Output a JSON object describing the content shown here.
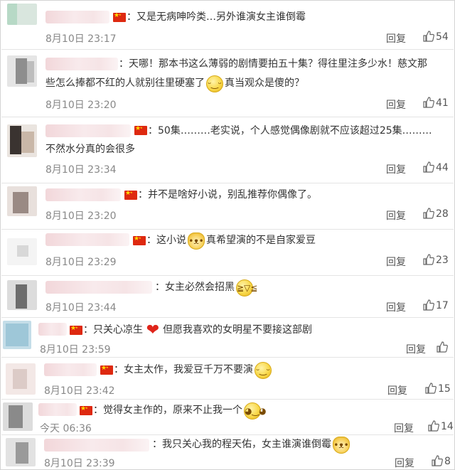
{
  "reply_label": "回复",
  "colors": {
    "flag_red": "#de2910",
    "flag_yellow": "#ffde00",
    "username_blur": "#f2d7da",
    "timestamp": "#888888"
  },
  "comments": [
    {
      "text": "：又是无病呻吟类…另外谁演女主谁倒霉",
      "time": "8月10日 23:17",
      "likes": "54"
    },
    {
      "text_line1": "：天哪！那本书这么薄弱的剧情要拍五十集？得往里注多少水！慈文那",
      "text_line2_a": "些怎么捧都不红的人就别往里硬塞了",
      "emoji": "thinking-emoji",
      "text_line2_b": "真当观众是傻的？",
      "time": "8月10日 23:20",
      "likes": "41"
    },
    {
      "text_line1": "：50集………老实说，个人感觉偶像剧就不应该超过25集………",
      "text_line2": "不然水分真的会很多",
      "time": "8月10日 23:34",
      "likes": "44"
    },
    {
      "text": "：并不是啥好小说，别乱推荐你偶像了。",
      "time": "8月10日 23:20",
      "likes": "28"
    },
    {
      "text_a": "：这小说",
      "emoji": "cat-emoji",
      "text_b": "真希望演的不是自家爱豆",
      "time": "8月10日 23:29",
      "likes": "23"
    },
    {
      "text": "：女主必然会招黑",
      "emoji": "laugh-cry-emoji",
      "time": "8月10日 23:44",
      "likes": "17"
    },
    {
      "text_a": "：只关心凉生",
      "emoji": "heart-emoji",
      "text_b": "但愿我喜欢的女明星不要接这部剧",
      "time": "8月10日 23:59",
      "likes": ""
    },
    {
      "text": "：女主太作，我爱豆千万不要演",
      "emoji": "thinking-emoji",
      "time": "8月10日 23:42",
      "likes": "15"
    },
    {
      "text": "：觉得女主作的，原来不止我一个",
      "emoji": "smile-emoji",
      "time": "今天 06:36",
      "likes": "14"
    },
    {
      "text": "：我只关心我的程天佑，女主谁演谁倒霉",
      "emoji": "cat-emoji",
      "time": "8月10日 23:39",
      "likes": "8"
    }
  ]
}
